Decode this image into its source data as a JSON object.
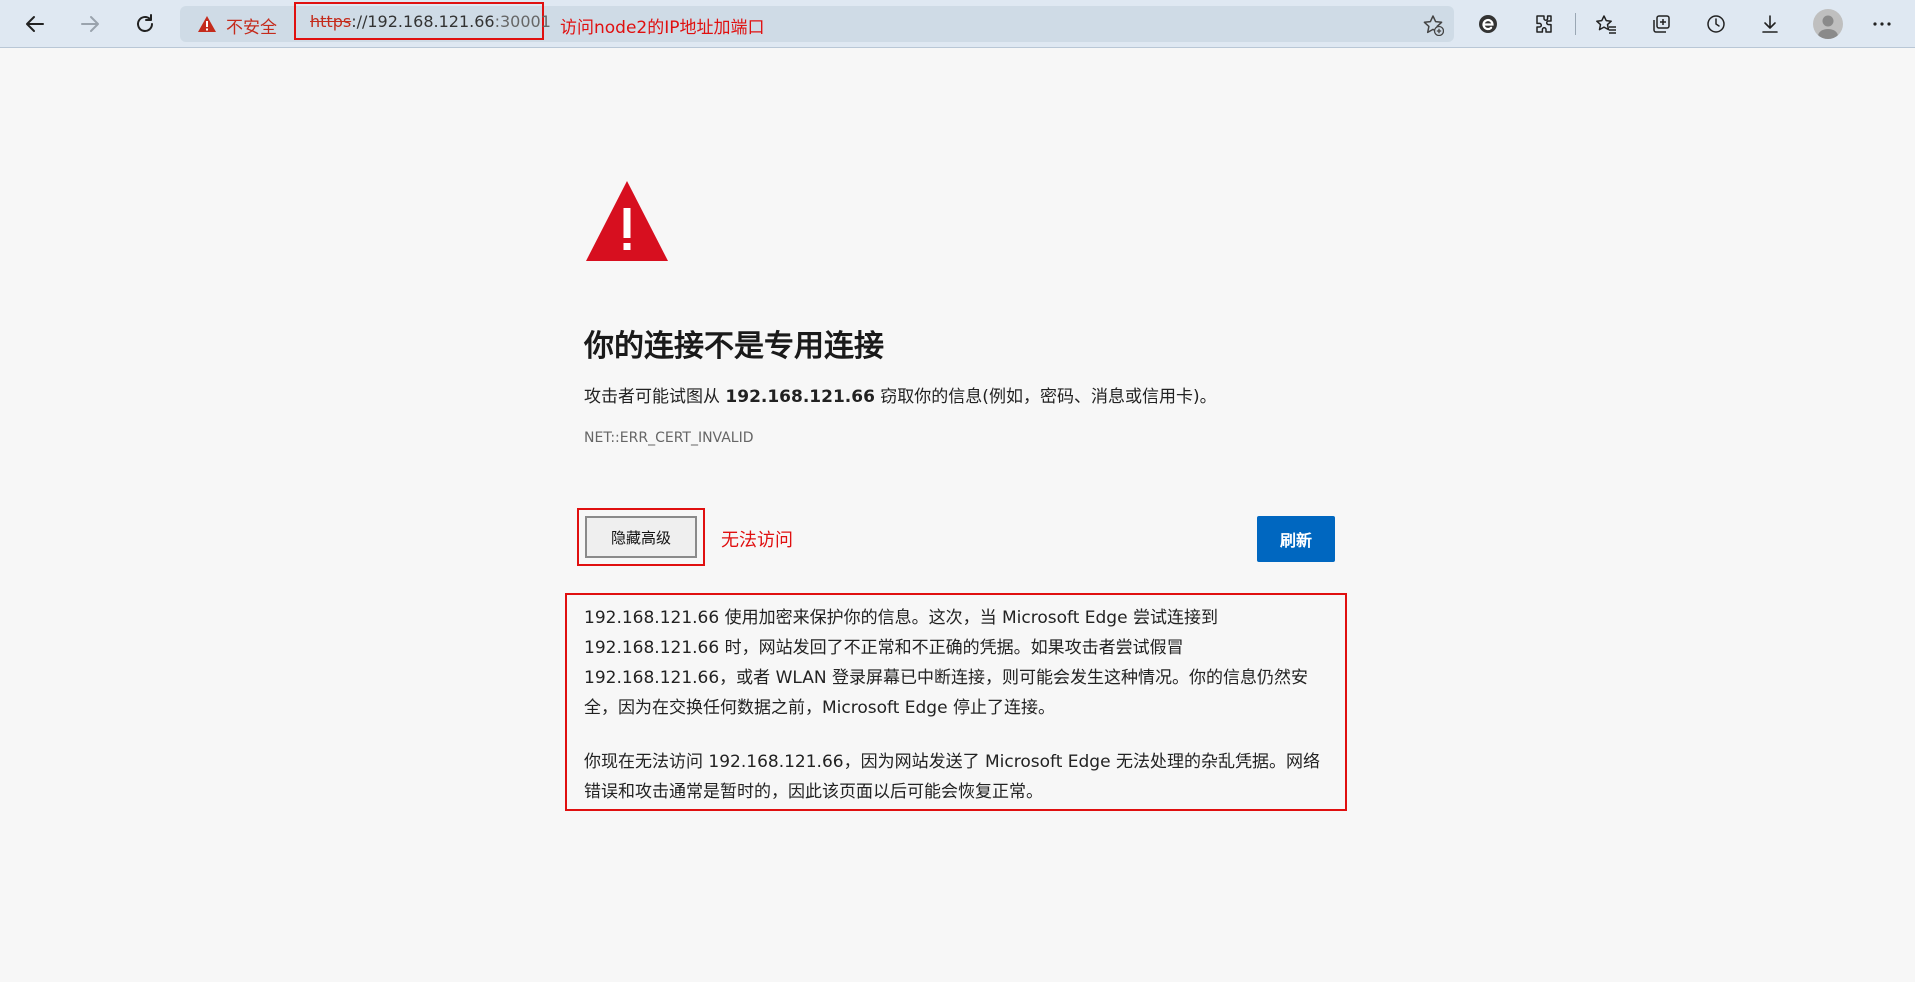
{
  "browser": {
    "security_label": "不安全",
    "url_scheme": "https",
    "url_host": "://192.168.121.66",
    "url_port": ":30001",
    "annotation_url": "访问node2的IP地址加端口"
  },
  "page": {
    "title": "你的连接不是专用连接",
    "desc_prefix": "攻击者可能试图从 ",
    "desc_host": "192.168.121.66",
    "desc_suffix": " 窃取你的信息(例如，密码、消息或信用卡)。",
    "error_code": "NET::ERR_CERT_INVALID",
    "advanced_button": "隐藏高级",
    "annotation_advanced": "无法访问",
    "refresh_button": "刷新",
    "details_paragraph_1": "192.168.121.66 使用加密来保护你的信息。这次，当 Microsoft Edge 尝试连接到 192.168.121.66 时，网站发回了不正常和不正确的凭据。如果攻击者尝试假冒 192.168.121.66，或者 WLAN 登录屏幕已中断连接，则可能会发生这种情况。你的信息仍然安全，因为在交换任何数据之前，Microsoft Edge 停止了连接。",
    "details_paragraph_2": "你现在无法访问 192.168.121.66，因为网站发送了 Microsoft Edge 无法处理的杂乱凭据。网络错误和攻击通常是暂时的，因此该页面以后可能会恢复正常。"
  },
  "colors": {
    "toolbar_bg": "#dfe8f2",
    "warning_red": "#d70f1f",
    "annotation_red": "#e01010",
    "refresh_blue": "#0067c0"
  },
  "icons": [
    "back-icon",
    "forward-icon",
    "refresh-icon",
    "warning-icon",
    "favorite-add-icon",
    "edge-icon",
    "extensions-icon",
    "favorites-icon",
    "collections-icon",
    "history-icon",
    "download-icon",
    "profile-avatar",
    "more-icon"
  ]
}
